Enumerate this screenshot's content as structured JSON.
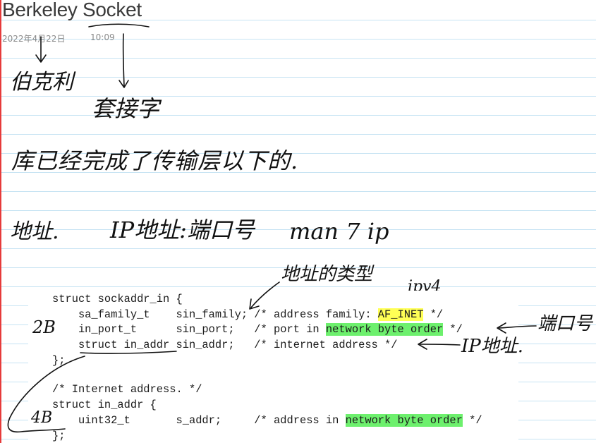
{
  "page": {
    "title": "Berkeley Socket",
    "date": "2022年4月22日",
    "time": "10:09"
  },
  "handwriting": {
    "berkeley_translation": "伯克利",
    "socket_translation": "套接字",
    "note_library": "库已经完成了传输层以下的.",
    "address_label": "地址.",
    "ip_port": "IP地址:端口号",
    "man_ip": "man 7 ip",
    "address_type": "地址的类型",
    "ipv4": "ipv4",
    "port_number": "端口号",
    "ip_address": "IP地址.",
    "two_bytes": "2B",
    "four_bytes": "4B"
  },
  "code": {
    "line1": "struct sockaddr_in {",
    "line2_prefix": "    sa_family_t    sin_family; /* address family: ",
    "line2_hl": "AF_INET",
    "line2_suffix": " */",
    "line3_prefix": "    in_port_t      sin_port;   /* port in ",
    "line3_hl": "network byte order",
    "line3_suffix": " */",
    "line4": "    struct in_addr sin_addr;   /* internet address */",
    "line5": "};",
    "line6": "/* Internet address. */",
    "line7": "struct in_addr {",
    "line8_prefix": "    uint32_t       s_addr;     /* address in ",
    "line8_hl": "network byte order",
    "line8_suffix": " */",
    "line9": "};"
  },
  "colors": {
    "margin_line": "#e63b3b",
    "ruled_line": "#c6e3f3",
    "highlight_yellow": "#ffff55",
    "highlight_green": "#6df06d",
    "ink": "#111111"
  }
}
